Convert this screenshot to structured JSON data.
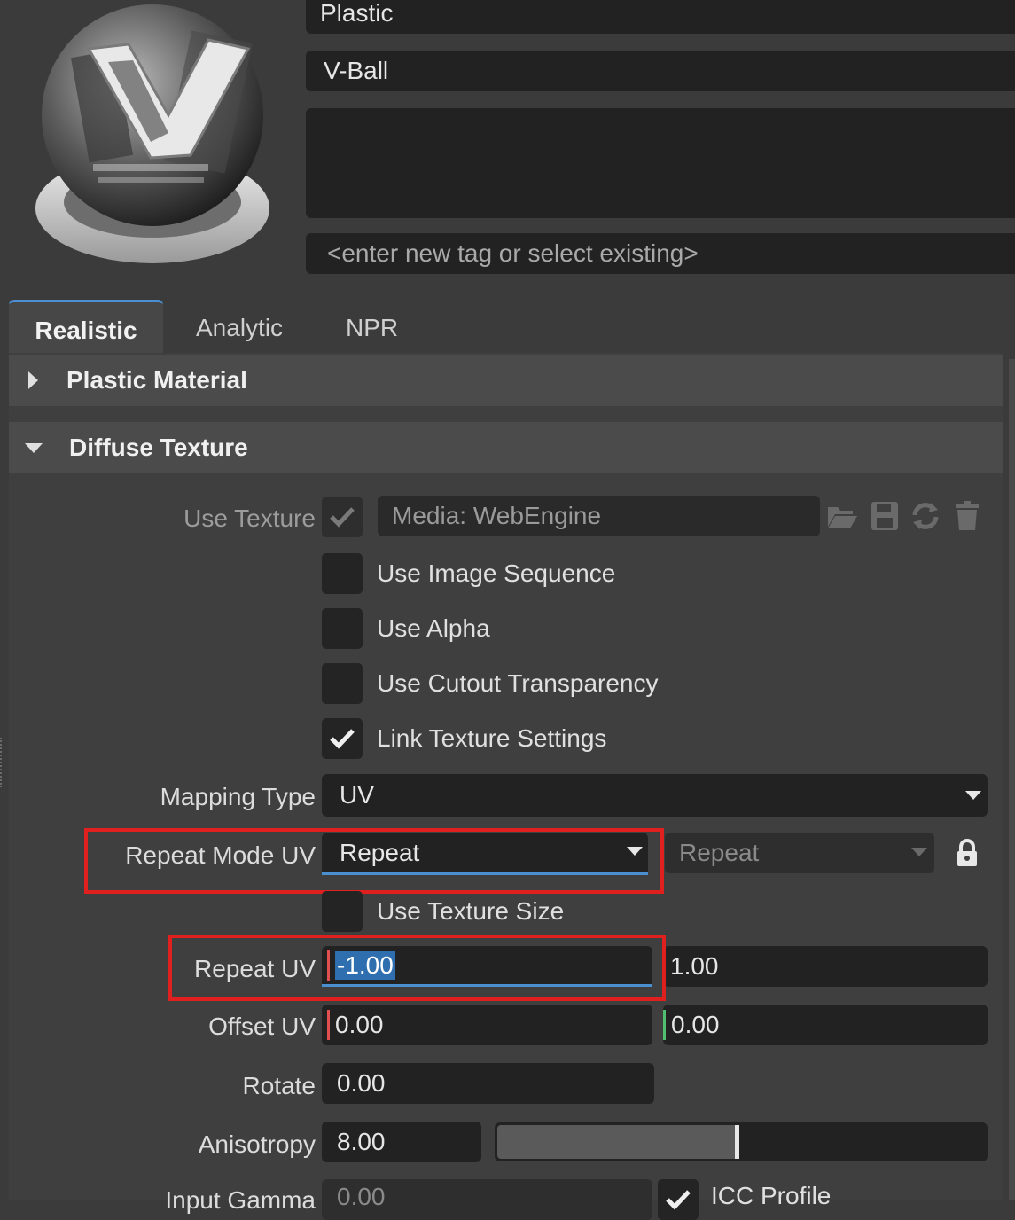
{
  "header": {
    "material_name": "Plastic",
    "preview_name": "V-Ball",
    "tag_placeholder": "<enter new tag or select existing>"
  },
  "tabs": [
    {
      "label": "Realistic",
      "active": true
    },
    {
      "label": "Analytic",
      "active": false
    },
    {
      "label": "NPR",
      "active": false
    }
  ],
  "sections": {
    "plastic_material": {
      "title": "Plastic Material",
      "expanded": false
    },
    "diffuse_texture": {
      "title": "Diffuse Texture",
      "expanded": true
    }
  },
  "diffuse": {
    "use_texture": {
      "label": "Use Texture",
      "checked": true,
      "media": "Media: WebEngine"
    },
    "use_image_sequence": {
      "label": "Use Image Sequence",
      "checked": false
    },
    "use_alpha": {
      "label": "Use Alpha",
      "checked": false
    },
    "use_cutout_transparency": {
      "label": "Use Cutout Transparency",
      "checked": false
    },
    "link_texture_settings": {
      "label": "Link Texture Settings",
      "checked": true
    },
    "mapping_type": {
      "label": "Mapping Type",
      "value": "UV"
    },
    "repeat_mode_uv": {
      "label": "Repeat Mode UV",
      "u": "Repeat",
      "v": "Repeat"
    },
    "use_texture_size": {
      "label": "Use Texture Size",
      "checked": false
    },
    "repeat_uv": {
      "label": "Repeat UV",
      "u": "-1.00",
      "v": "1.00"
    },
    "offset_uv": {
      "label": "Offset UV",
      "u": "0.00",
      "v": "0.00"
    },
    "rotate": {
      "label": "Rotate",
      "value": "0.00"
    },
    "anisotropy": {
      "label": "Anisotropy",
      "value": "8.00",
      "slider_fraction": 0.49
    },
    "input_gamma": {
      "label": "Input Gamma",
      "value": "0.00"
    },
    "icc_profile": {
      "label": "ICC Profile",
      "checked": true
    }
  },
  "colors": {
    "background": "#3b3b3b",
    "field": "#222222",
    "accent_blue": "#4a90d0",
    "highlight_red": "#e0201e",
    "u_axis": "#e05050",
    "v_axis": "#50c070"
  }
}
